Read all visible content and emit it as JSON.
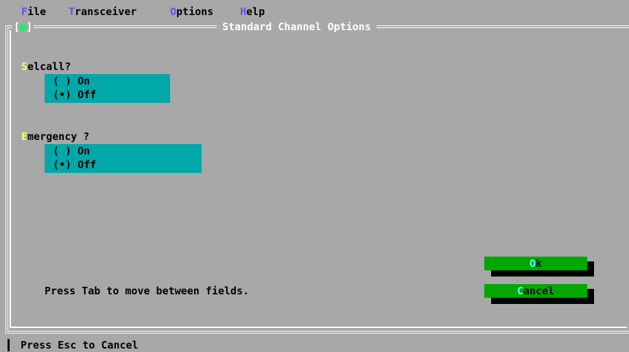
{
  "colors": {
    "background": "#a8a8a8",
    "menu_hotkey": "#5555ff",
    "label_hotkey": "#ffff55",
    "button_hotkey": "#55ffff",
    "radio_group_bg": "#00a8a8",
    "button_bg": "#00a800",
    "frame": "#ffffff",
    "close_marker": "#00ff55"
  },
  "menu": [
    {
      "hotkey": "F",
      "rest": "ile"
    },
    {
      "hotkey": "T",
      "rest": "ransceiver"
    },
    {
      "hotkey": "O",
      "rest": "ptions"
    },
    {
      "hotkey": "H",
      "rest": "elp"
    }
  ],
  "window": {
    "close_left": "[",
    "close_mark": "■",
    "close_right": "]",
    "title": "Standard Channel Options"
  },
  "selcall": {
    "label_hotkey": "S",
    "label_rest": "elcall?",
    "options": [
      "( ) On",
      "(•) Off"
    ],
    "selected": 1
  },
  "emergency": {
    "label_hotkey": "E",
    "label_rest": "mergency ?",
    "options": [
      "( ) On",
      "(•) Off"
    ],
    "selected": 1
  },
  "hint": "Press Tab to move between fields.",
  "buttons": {
    "ok": {
      "hotkey": "O",
      "rest": "k"
    },
    "cancel": {
      "hotkey": "C",
      "rest": "ancel"
    }
  },
  "status": "Press Esc to Cancel"
}
